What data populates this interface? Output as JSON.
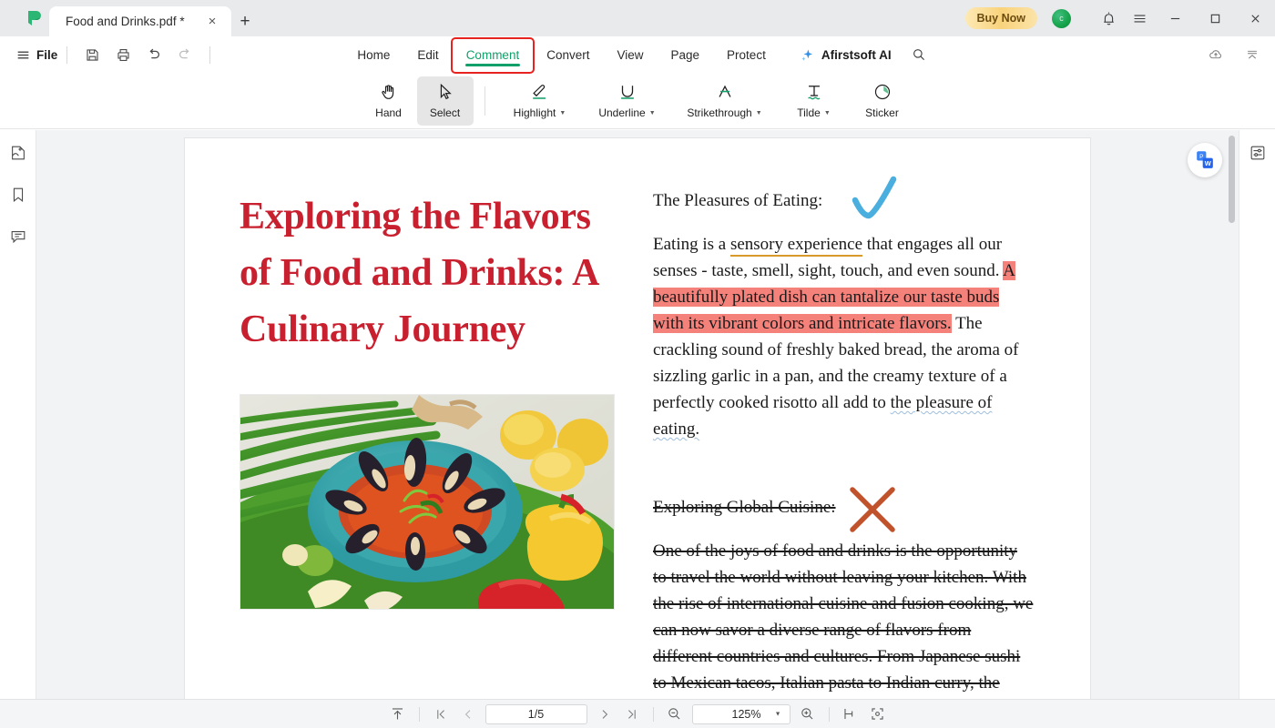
{
  "window": {
    "tab_title": "Food and Drinks.pdf *",
    "close_tab_label": "×",
    "new_tab_label": "+",
    "buy_now_label": "Buy Now",
    "avatar_initial": "c",
    "minimize_label": "—",
    "maximize_label": "□",
    "close_label": "×"
  },
  "menubar": {
    "file_label": "File",
    "tabs": [
      {
        "label": "Home",
        "active": false
      },
      {
        "label": "Edit",
        "active": false
      },
      {
        "label": "Comment",
        "active": true
      },
      {
        "label": "Convert",
        "active": false
      },
      {
        "label": "View",
        "active": false
      },
      {
        "label": "Page",
        "active": false
      },
      {
        "label": "Protect",
        "active": false
      }
    ],
    "ai_label": "Afirstsoft AI"
  },
  "toolbar": {
    "tools": [
      {
        "label": "Hand",
        "icon": "hand-icon",
        "caret": false,
        "active": false
      },
      {
        "label": "Select",
        "icon": "cursor-icon",
        "caret": false,
        "active": true
      },
      {
        "label": "Highlight",
        "icon": "highlight-icon",
        "caret": true,
        "active": false
      },
      {
        "label": "Underline",
        "icon": "underline-icon",
        "caret": true,
        "active": false
      },
      {
        "label": "Strikethrough",
        "icon": "strikethrough-icon",
        "caret": true,
        "active": false
      },
      {
        "label": "Tilde",
        "icon": "tilde-icon",
        "caret": true,
        "active": false
      },
      {
        "label": "Sticker",
        "icon": "sticker-icon",
        "caret": false,
        "active": false
      }
    ]
  },
  "document": {
    "title": "Exploring the Flavors of Food and Drinks: A Culinary Journey",
    "section1": {
      "heading": "The Pleasures of Eating:",
      "p1_a": "Eating is a ",
      "p1_underlined": "sensory experience",
      "p1_b": " that engages all our senses - taste, smell, sight, touch, and even sound. ",
      "p1_highlight": "A beautifully plated dish can tantalize our taste buds with its vibrant colors and intricate flavors.",
      "p1_c": " The crackling sound of freshly baked bread, the aroma of sizzling garlic in a pan, and the creamy texture of a perfectly cooked risotto all add to ",
      "p1_wavy": "the pleasure of eating."
    },
    "section2": {
      "heading": "Exploring Global Cuisine:",
      "p2": "One of the joys of food and drinks is the opportunity to travel the world without leaving your kitchen. With the rise of international cuisine and fusion cooking, we can now savor a diverse range of flavors from different countries and cultures. From Japanese sushi to Mexican tacos, Italian pasta to Indian curry, the world is a"
    }
  },
  "statusbar": {
    "page_value": "1/5",
    "zoom_value": "125%"
  },
  "colors": {
    "accent_green": "#12a06a",
    "title_red": "#c9202f",
    "highlight_red": "#f5817b",
    "underline_orange": "#d79a2b",
    "sticker_check_blue": "#4aaede",
    "sticker_x_red": "#c0522c",
    "callout_box_red": "#e8221f",
    "buy_now_gold": "#f9d37c"
  }
}
